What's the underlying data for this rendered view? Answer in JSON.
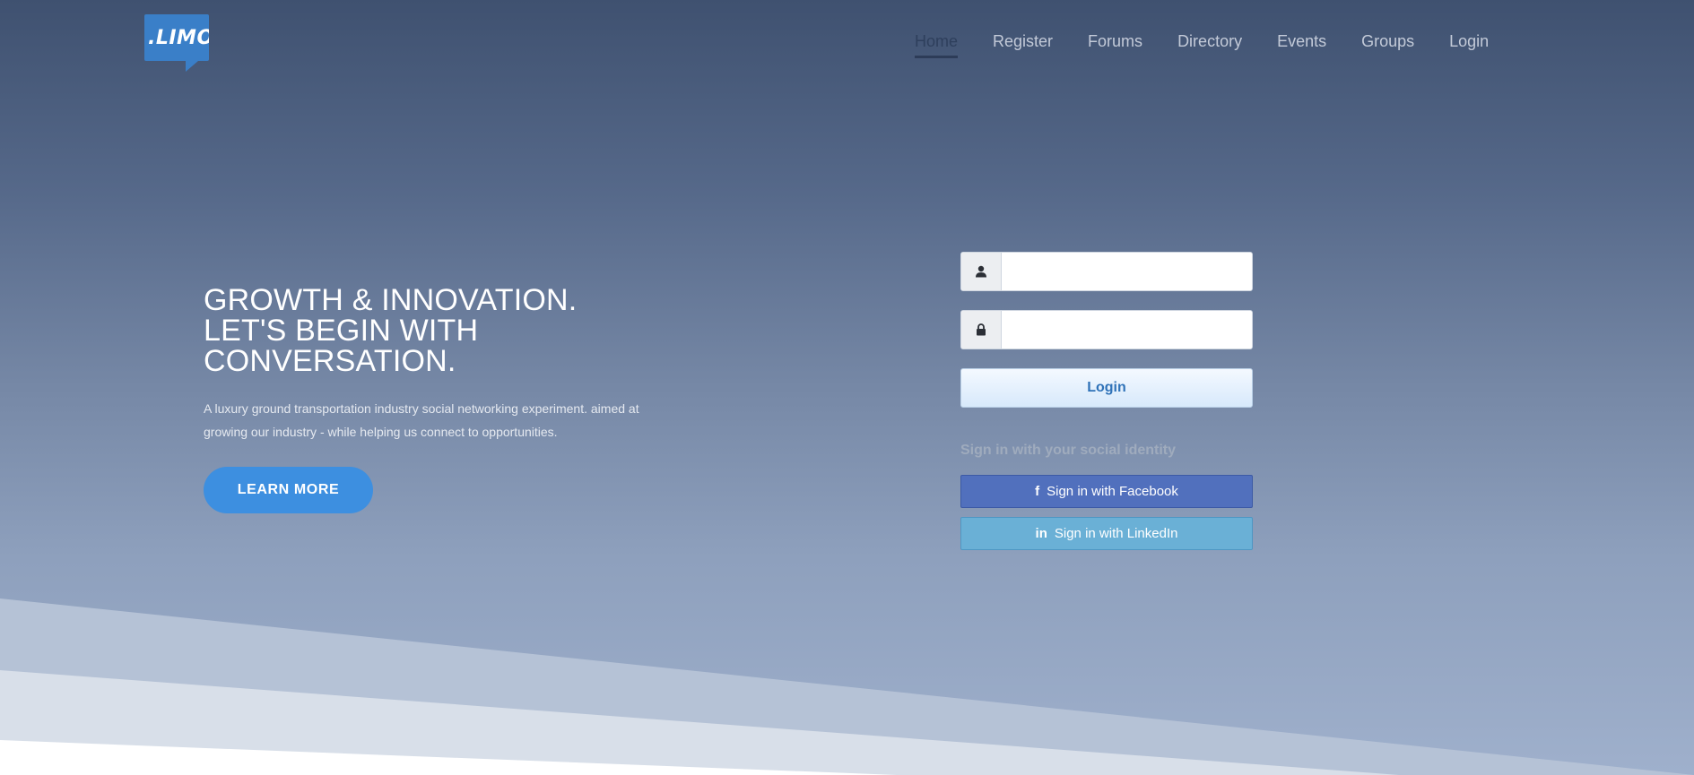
{
  "logo": {
    "text": ".LIMO"
  },
  "nav": {
    "items": [
      {
        "label": "Home",
        "active": true
      },
      {
        "label": "Register",
        "active": false
      },
      {
        "label": "Forums",
        "active": false
      },
      {
        "label": "Directory",
        "active": false
      },
      {
        "label": "Events",
        "active": false
      },
      {
        "label": "Groups",
        "active": false
      },
      {
        "label": "Login",
        "active": false
      }
    ]
  },
  "hero": {
    "title_lines": [
      "GROWTH & INNOVATION.",
      "LET'S BEGIN WITH",
      "CONVERSATION."
    ],
    "description": "A luxury ground transportation industry social networking experiment. aimed at growing our industry - while helping us connect to opportunities.",
    "cta_label": "LEARN MORE"
  },
  "login_form": {
    "username_value": "",
    "username_icon": "user-icon",
    "password_value": "",
    "password_icon": "lock-icon",
    "submit_label": "Login"
  },
  "social": {
    "heading": "Sign in with your social identity",
    "facebook_label": "Sign in with Facebook",
    "facebook_icon": "facebook-icon",
    "linkedin_label": "Sign in with LinkedIn",
    "linkedin_icon": "linkedin-icon"
  },
  "colors": {
    "accent": "#3d8fe0",
    "facebook": "#5170bd",
    "linkedin": "#6ab0d6",
    "header_bg": "#3f5170"
  }
}
